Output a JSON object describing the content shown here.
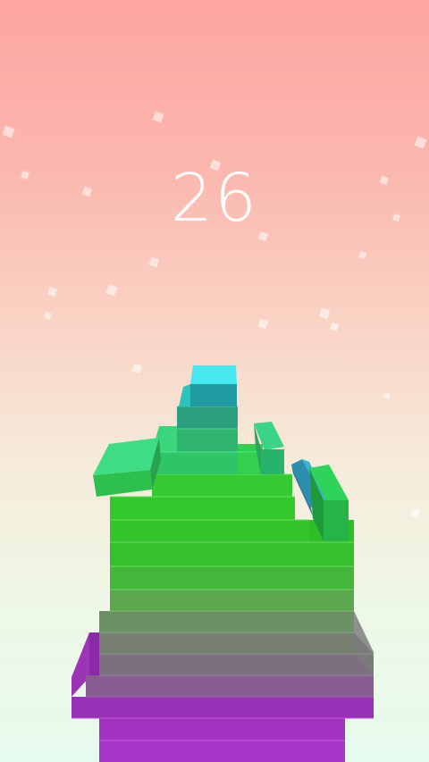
{
  "game": {
    "score": "26"
  },
  "colors": {
    "sky_top": "#fda5a1",
    "sky_bottom": "#e6faee",
    "block_top_cyan": "#40e0e8",
    "block_green": "#2ec62a",
    "block_gray": "#7b7f78",
    "block_purple": "#a42fc4"
  },
  "icons": [
    "falling-block-debris",
    "sparkle-particle"
  ]
}
